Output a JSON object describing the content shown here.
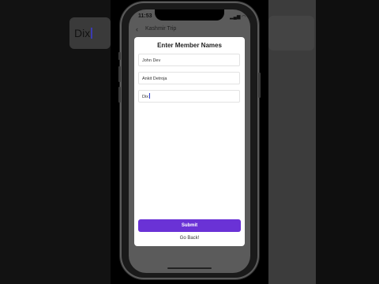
{
  "status_bar": {
    "time": "11:53",
    "icons": "▂▄▆ ◠ ▭"
  },
  "nav": {
    "back_icon": "‹",
    "title": "Kashmir Trip"
  },
  "modal": {
    "title": "Enter Member Names",
    "fields": [
      {
        "value": "John Dev"
      },
      {
        "value": "Ankit Detroja"
      },
      {
        "value": "Dix"
      }
    ],
    "submit_label": "Submit",
    "goback_label": "Go Back!"
  },
  "background": {
    "left_text": "Dix"
  },
  "colors": {
    "accent": "#6a32d6"
  }
}
